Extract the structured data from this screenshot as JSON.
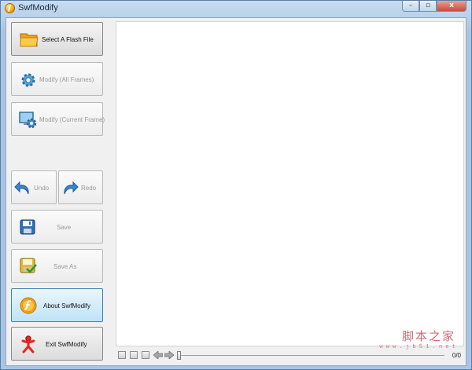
{
  "window": {
    "title": "SwfModify",
    "controls": [
      "–",
      "▫",
      "x"
    ]
  },
  "sidebar": {
    "select_file": {
      "label": "Select A Flash File",
      "icon": "folder-icon",
      "enabled": true
    },
    "modify_all": {
      "label": "Modify (All Frames)",
      "icon": "gear-icon",
      "enabled": false
    },
    "modify_current": {
      "label": "Modify (Current Frame)",
      "icon": "monitor-gear-icon",
      "enabled": false
    },
    "undo": {
      "label": "Undo",
      "icon": "undo-arrow-icon",
      "enabled": false
    },
    "redo": {
      "label": "Redo",
      "icon": "redo-arrow-icon",
      "enabled": false
    },
    "save": {
      "label": "Save",
      "icon": "floppy-disk-icon",
      "enabled": false
    },
    "save_as": {
      "label": "Save As",
      "icon": "floppy-disk-check-icon",
      "enabled": false
    },
    "about": {
      "label": "About SwfModify",
      "icon": "flash-logo-icon",
      "enabled": true,
      "highlighted": true
    },
    "exit": {
      "label": "Exit SwfModify",
      "icon": "running-person-icon",
      "enabled": true
    }
  },
  "player": {
    "frame_counter": "0/0"
  },
  "watermark": {
    "main": "脚本之家",
    "sub": "w w w . j b 5 1 . n e t"
  },
  "colors": {
    "highlight_border": "#3c7fb1",
    "highlight_fill": "#bfe3f7",
    "disabled_text": "#9a9a9a"
  }
}
